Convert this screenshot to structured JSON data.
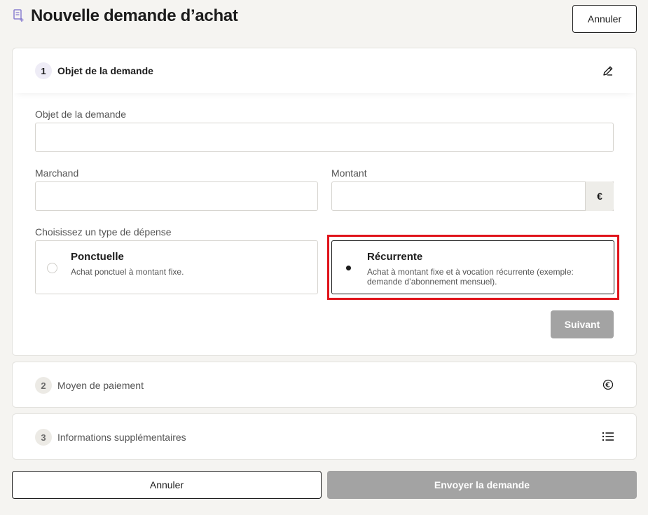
{
  "header": {
    "title": "Nouvelle demande d’achat",
    "cancel_label": "Annuler",
    "icon": "receipt-plus-icon"
  },
  "steps": [
    {
      "number": "1",
      "label": "Objet de la demande",
      "icon": "pencil-icon",
      "state": "active"
    },
    {
      "number": "2",
      "label": "Moyen de paiement",
      "icon": "euro-circle-icon",
      "state": "pending"
    },
    {
      "number": "3",
      "label": "Informations supplémentaires",
      "icon": "list-icon",
      "state": "pending"
    }
  ],
  "form": {
    "subject": {
      "label": "Objet de la demande",
      "value": ""
    },
    "merchant": {
      "label": "Marchand",
      "value": ""
    },
    "amount": {
      "label": "Montant",
      "value": "",
      "currency": "€"
    },
    "expense_type": {
      "label": "Choisissez un type de dépense",
      "selected": "Récurrente",
      "options": [
        {
          "title": "Ponctuelle",
          "description": "Achat ponctuel à montant fixe."
        },
        {
          "title": "Récurrente",
          "description": "Achat à montant fixe et à vocation récurrente (exemple: demande d’abonnement mensuel)."
        }
      ]
    },
    "next_label": "Suivant"
  },
  "footer": {
    "cancel_label": "Annuler",
    "submit_label": "Envoyer la demande"
  },
  "colors": {
    "highlight": "#e0141b",
    "disabled_button": "#a3a3a3",
    "background": "#f5f4f1"
  }
}
